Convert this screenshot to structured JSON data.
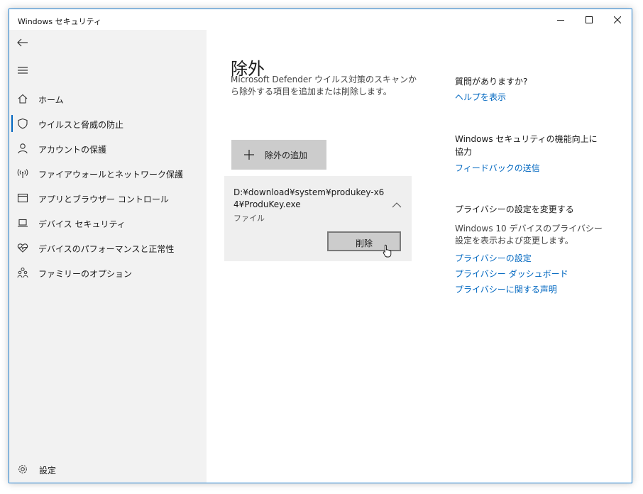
{
  "window": {
    "title": "Windows セキュリティ",
    "accent": "#0067c0"
  },
  "sidebar": {
    "items": [
      {
        "label": "ホーム",
        "icon": "home-icon"
      },
      {
        "label": "ウイルスと脅威の防止",
        "icon": "shield-icon",
        "active": true
      },
      {
        "label": "アカウントの保護",
        "icon": "person-icon"
      },
      {
        "label": "ファイアウォールとネットワーク保護",
        "icon": "wifi-signal-icon"
      },
      {
        "label": "アプリとブラウザー コントロール",
        "icon": "browser-window-icon"
      },
      {
        "label": "デバイス セキュリティ",
        "icon": "laptop-icon"
      },
      {
        "label": "デバイスのパフォーマンスと正常性",
        "icon": "heart-pulse-icon"
      },
      {
        "label": "ファミリーのオプション",
        "icon": "family-icon"
      }
    ],
    "settings_label": "設定"
  },
  "main": {
    "title": "除外",
    "description": "Microsoft Defender ウイルス対策のスキャンから除外する項目を追加または削除します。",
    "add_button_label": "除外の追加",
    "exclusion": {
      "path": "D:¥download¥system¥produkey-x64¥ProduKey.exe",
      "type": "ファイル",
      "delete_label": "削除"
    }
  },
  "right_panel": {
    "help_heading": "質問がありますか?",
    "help_link": "ヘルプを表示",
    "feedback_heading": "Windows セキュリティの機能向上に協力",
    "feedback_link": "フィードバックの送信",
    "privacy_heading": "プライバシーの設定を変更する",
    "privacy_text": "Windows 10 デバイスのプライバシー設定を表示および変更します。",
    "privacy_links": [
      "プライバシーの設定",
      "プライバシー ダッシュボード",
      "プライバシーに関する声明"
    ]
  }
}
